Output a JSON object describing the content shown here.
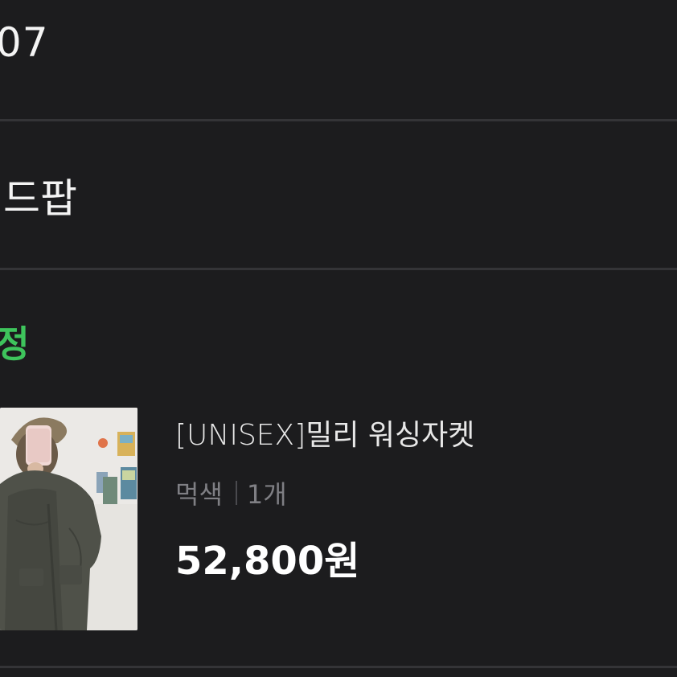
{
  "order": {
    "date_fragment": ".07",
    "shop_name_fragment": "앤드팝",
    "status_fragment": "확정"
  },
  "product": {
    "name": "[UNISEX]밀리 워싱자켓",
    "option_color": "먹색",
    "option_quantity": "1개",
    "price": "52,800원",
    "image": "product-thumbnail"
  },
  "colors": {
    "background": "#1c1c1e",
    "divider": "#343437",
    "status_green": "#3ec45c",
    "muted_text": "#7f7f84"
  }
}
